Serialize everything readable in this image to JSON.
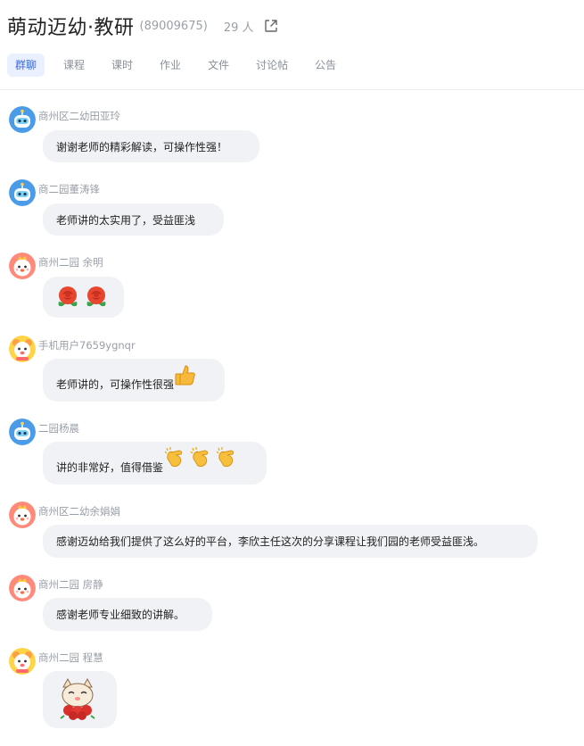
{
  "header": {
    "group_name": "萌动迈幼·教研",
    "group_id": "(89009675)",
    "member_count": "29 人",
    "open_icon": "external-link-icon"
  },
  "tabs": [
    {
      "label": "群聊",
      "active": true
    },
    {
      "label": "课程",
      "active": false
    },
    {
      "label": "课时",
      "active": false
    },
    {
      "label": "作业",
      "active": false
    },
    {
      "label": "文件",
      "active": false
    },
    {
      "label": "讨论帖",
      "active": false
    },
    {
      "label": "公告",
      "active": false
    }
  ],
  "messages": [
    {
      "sender": "商州区二幼田亚玲",
      "avatar": "robot-avatar-icon",
      "text": "谢谢老师的精彩解读，可操作性强！"
    },
    {
      "sender": "商二园董涛锋",
      "avatar": "robot-avatar-icon",
      "text": "老师讲的太实用了，受益匪浅"
    },
    {
      "sender": "商州二园 余明",
      "avatar": "chick-avatar-icon",
      "text": "",
      "emojis": [
        "rose-icon",
        "rose-icon"
      ]
    },
    {
      "sender": "手机用户7659ygnqr",
      "avatar": "bear-avatar-icon",
      "text": "老师讲的，可操作性很强",
      "emojis": [
        "thumbs-up-icon"
      ]
    },
    {
      "sender": "二园杨晨",
      "avatar": "robot-avatar-icon",
      "text": "讲的非常好，值得借鉴",
      "emojis": [
        "clap-icon",
        "clap-icon",
        "clap-icon"
      ]
    },
    {
      "sender": "商州区二幼余娟娟",
      "avatar": "chick-avatar-icon",
      "text": "感谢迈幼给我们提供了这么好的平台，李欣主任这次的分享课程让我们园的老师受益匪浅。"
    },
    {
      "sender": "商州二园 房静",
      "avatar": "chick-avatar-icon",
      "text": "感谢老师专业细致的讲解。"
    },
    {
      "sender": "商州二园 程慧",
      "avatar": "bear-avatar-icon",
      "text": "",
      "sticker": "cat-with-roses-sticker"
    }
  ],
  "colors": {
    "accent": "#3b6ae0",
    "tab_active_bg": "#eaf0ff",
    "bubble_bg": "#f0f2f5",
    "meta_text": "#9aa0a8"
  }
}
